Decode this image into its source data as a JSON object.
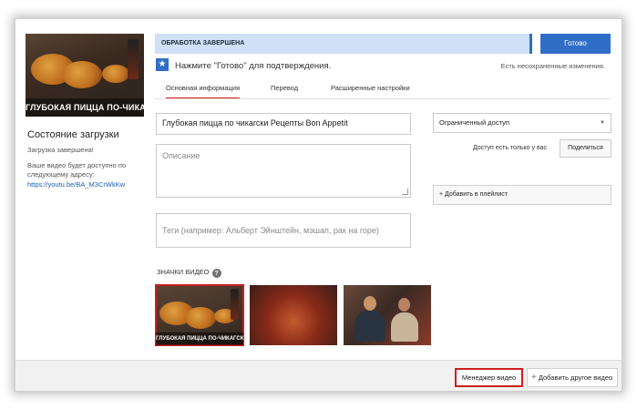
{
  "video": {
    "thumbnail_caption": "ГЛУБОКАЯ ПИЦЦА ПО-ЧИКАГСКИ"
  },
  "upload_status": {
    "title": "Состояние загрузки",
    "complete": "Загрузка завершена!",
    "available_line1": "Ваше видео будет доступно по",
    "available_line2": "следующему адресу:",
    "link": "https://youtu.be/BA_M3CrWkKw"
  },
  "top_bar": {
    "processing": "ОБРАБОТКА ЗАВЕРШЕНА",
    "done_label": "Готово",
    "hint": "Нажмите \"Готово\" для подтверждения.",
    "unsaved": "Есть несохраненные изменения."
  },
  "tabs": [
    {
      "label": "Основная информация",
      "active": true
    },
    {
      "label": "Перевод",
      "active": false
    },
    {
      "label": "Расширенные настройки",
      "active": false
    }
  ],
  "form": {
    "title_value": "Глубокая пицца по чикагски Рецепты Bon Appetit",
    "description_placeholder": "Описание",
    "tags_placeholder": "Теги (например: Альберт Эйнштейн, мэшап, рак на горе)"
  },
  "privacy": {
    "selected": "Ограниченный доступ",
    "note": "Доступ есть только у вас",
    "share_label": "Поделиться",
    "playlist_label": "+ Добавить в плейлист"
  },
  "thumbnails": {
    "label": "ЗНАЧКИ ВИДЕО",
    "help": "?",
    "selected_index": 0
  },
  "footer": {
    "manager_label": "Менеджер видео",
    "add_other_label": "Добавить другое видео",
    "add_plus": "+"
  },
  "colors": {
    "accent_blue": "#2f6ec7",
    "processing_bg": "#cfe0f7",
    "highlight_red": "#cc1e1e"
  },
  "icons": {
    "star": "★",
    "caret": "▼"
  }
}
